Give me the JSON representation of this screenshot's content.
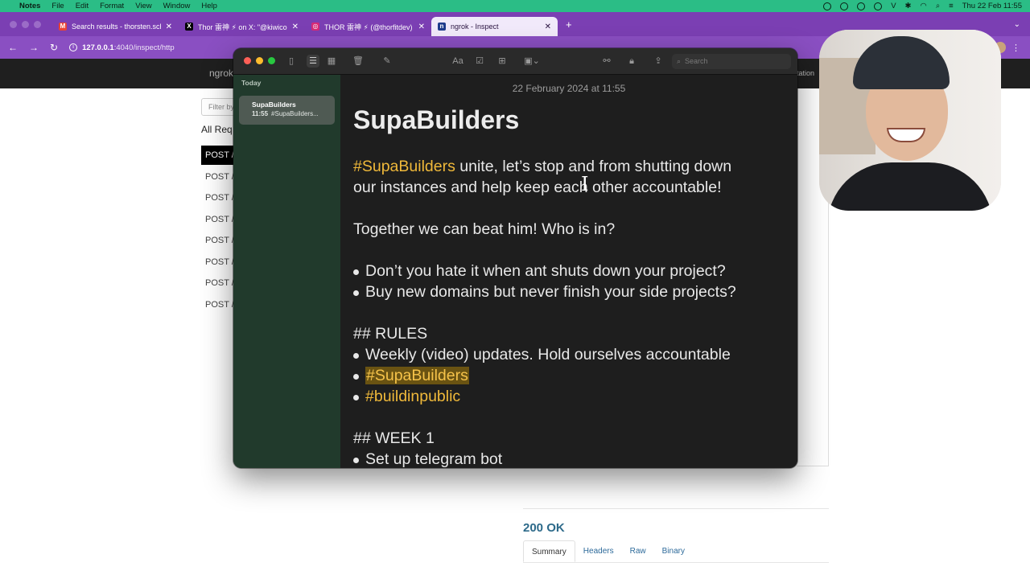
{
  "menubar": {
    "app": "Notes",
    "items": [
      "File",
      "Edit",
      "Format",
      "View",
      "Window",
      "Help"
    ],
    "datetime": "Thu 22 Feb  11:55"
  },
  "browser": {
    "tabs": [
      {
        "title": "Search results - thorsten.sch",
        "favicon_color": "#ea4335",
        "glyph": "M"
      },
      {
        "title": "Thor 雷神 ⚡ on X: \"@kiwicop",
        "favicon_color": "#000000",
        "glyph": "X"
      },
      {
        "title": "THOR 雷神 ⚡ (@thorfitdev) •",
        "favicon_color": "#d62976",
        "glyph": "◎"
      },
      {
        "title": "ngrok - Inspect",
        "favicon_color": "#1f3b8c",
        "glyph": "n"
      }
    ],
    "url_host": "127.0.0.1",
    "url_path": ":4040/inspect/http"
  },
  "ngrok": {
    "brand": "ngrok",
    "right_link": "ntation",
    "filter_placeholder": "Filter by",
    "all_requests": "All Req",
    "rows": [
      "POST /",
      "POST /",
      "POST /",
      "POST /",
      "POST /",
      "POST /",
      "POST /",
      "POST /"
    ],
    "status": "200 OK",
    "tabs": [
      "Summary",
      "Headers",
      "Raw",
      "Binary"
    ]
  },
  "notes": {
    "sidebar_heading": "Today",
    "card": {
      "title": "SupaBuilders",
      "time": "11:55",
      "preview": "#SupaBuilders..."
    },
    "search_placeholder": "Search",
    "date": "22 February 2024 at 11:55",
    "title": "SupaBuilders",
    "p1_tag": "#SupaBuilders",
    "p1_rest": " unite, let’s stop and from shutting down",
    "p1_line2": "our instances and help keep each other accountable!",
    "p2": "Together we can beat him! Who is in?",
    "bullets1": [
      "Don’t you hate it when ant shuts down your project?",
      "Buy new domains but never finish your side projects?"
    ],
    "rules_heading": "## RULES",
    "rule1": "Weekly (video) updates. Hold ourselves accountable",
    "rule2": "#SupaBuilders",
    "rule3": "#buildinpublic",
    "week_heading": "## WEEK 1",
    "week1": "Set up telegram bot"
  }
}
